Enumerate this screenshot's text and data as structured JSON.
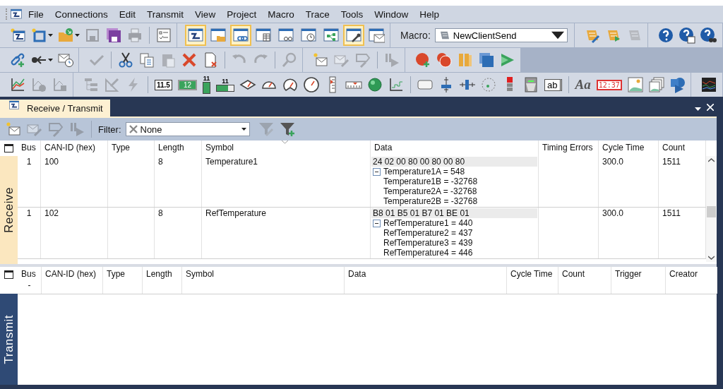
{
  "menu_bar": {
    "items": [
      "File",
      "Connections",
      "Edit",
      "Transmit",
      "View",
      "Project",
      "Macro",
      "Trace",
      "Tools",
      "Window",
      "Help"
    ]
  },
  "toolbars": [
    {
      "groups": [
        {
          "items": [
            {
              "kind": "network-window",
              "disabled": false
            },
            {
              "kind": "window-sparkle",
              "disabled": false,
              "dropdown": true
            },
            {
              "kind": "folder-arrow",
              "disabled": false,
              "dropdown": true
            },
            {
              "kind": "floppy",
              "disabled": true
            },
            {
              "kind": "floppy-stack",
              "disabled": false
            },
            {
              "kind": "printer",
              "disabled": true
            },
            {
              "kind": "separator"
            },
            {
              "kind": "checklist",
              "disabled": false
            }
          ]
        },
        {
          "items": [
            {
              "kind": "window-network",
              "on": true
            },
            {
              "kind": "window-folder",
              "on": false
            },
            {
              "kind": "window-link",
              "on": true
            },
            {
              "kind": "window-table",
              "on": false
            },
            {
              "kind": "window-glasses",
              "on": false
            },
            {
              "kind": "window-clock",
              "on": false
            },
            {
              "kind": "window-nodes",
              "on": false
            },
            {
              "kind": "window-wrench",
              "on": true
            },
            {
              "kind": "window-envelope",
              "on": false
            }
          ]
        },
        {
          "items": [
            {
              "kind": "label",
              "text": "Macro:"
            },
            {
              "kind": "combo",
              "text": "NewClientSend"
            }
          ]
        },
        {
          "items": [
            {
              "kind": "scroll-pencil",
              "disabled": false
            },
            {
              "kind": "scroll-play",
              "disabled": false
            },
            {
              "kind": "scroll",
              "disabled": true
            }
          ]
        },
        {
          "items": [
            {
              "kind": "help",
              "disabled": false
            },
            {
              "kind": "help-window",
              "disabled": false
            },
            {
              "kind": "help-binoculars",
              "disabled": false
            }
          ]
        }
      ]
    },
    {
      "groups": [
        {
          "items": [
            {
              "kind": "link-plus",
              "disabled": false
            },
            {
              "kind": "plug-arrow",
              "disabled": false,
              "dropdown": true
            },
            {
              "kind": "envelope-clock",
              "disabled": false
            }
          ]
        },
        {
          "items": [
            {
              "kind": "checkmark",
              "disabled": true
            },
            {
              "kind": "separator"
            },
            {
              "kind": "scissors",
              "disabled": false
            },
            {
              "kind": "copy",
              "disabled": false
            },
            {
              "kind": "paste",
              "disabled": true
            },
            {
              "kind": "delete-x",
              "disabled": false
            },
            {
              "kind": "document-x",
              "disabled": false
            },
            {
              "kind": "separator"
            },
            {
              "kind": "undo",
              "disabled": true
            },
            {
              "kind": "redo",
              "disabled": true
            },
            {
              "kind": "separator"
            },
            {
              "kind": "magnifier",
              "disabled": true
            }
          ]
        },
        {
          "items": [
            {
              "kind": "envelope-sparkle",
              "disabled": false
            },
            {
              "kind": "envelope-pencil",
              "disabled": true
            },
            {
              "kind": "tag-pencil",
              "disabled": true
            },
            {
              "kind": "separator"
            },
            {
              "kind": "step-play",
              "disabled": true
            }
          ]
        },
        {
          "items": [
            {
              "kind": "record-plus",
              "disabled": false
            },
            {
              "kind": "record-double",
              "disabled": false
            },
            {
              "kind": "pause-bars",
              "disabled": false
            },
            {
              "kind": "stop-squares",
              "disabled": false
            },
            {
              "kind": "play-double",
              "disabled": false
            }
          ]
        }
      ]
    },
    {
      "groups": [
        {
          "items": [
            {
              "kind": "line-chart",
              "disabled": false
            },
            {
              "kind": "chart-circle",
              "disabled": true
            },
            {
              "kind": "chart-square",
              "disabled": true
            }
          ]
        },
        {
          "items": [
            {
              "kind": "tree",
              "disabled": true
            },
            {
              "kind": "ruler-pencil",
              "disabled": true
            },
            {
              "kind": "lightning",
              "disabled": true
            },
            {
              "kind": "separator"
            },
            {
              "kind": "number-display",
              "text": "11.5",
              "disabled": false
            },
            {
              "kind": "digital-display",
              "text": "12",
              "disabled": false
            },
            {
              "kind": "vertical-bar",
              "text": "11",
              "disabled": false
            },
            {
              "kind": "horizontal-bar",
              "text": "11",
              "disabled": false
            },
            {
              "kind": "gauge-flat",
              "disabled": false
            },
            {
              "kind": "gauge-half",
              "disabled": false
            },
            {
              "kind": "gauge-round",
              "disabled": false
            },
            {
              "kind": "gauge-full",
              "disabled": false
            },
            {
              "kind": "vertical-scale",
              "disabled": false
            },
            {
              "kind": "horizontal-scale",
              "disabled": false
            },
            {
              "kind": "ball",
              "disabled": false
            },
            {
              "kind": "small-chart",
              "disabled": false
            },
            {
              "kind": "separator"
            },
            {
              "kind": "rounded-button",
              "disabled": false
            },
            {
              "kind": "vertical-slider",
              "disabled": false
            },
            {
              "kind": "horizontal-slider",
              "disabled": false
            },
            {
              "kind": "led-dial",
              "disabled": false
            },
            {
              "kind": "signal-light",
              "disabled": false
            },
            {
              "kind": "switch-box",
              "disabled": false
            },
            {
              "kind": "text-box",
              "text": "ab",
              "disabled": false
            },
            {
              "kind": "separator"
            },
            {
              "kind": "italic-text",
              "text": "Aa",
              "disabled": false
            },
            {
              "kind": "clock-display",
              "text": "12:37",
              "disabled": false
            },
            {
              "kind": "picture-frame",
              "disabled": false
            },
            {
              "kind": "picture-stack",
              "disabled": false
            },
            {
              "kind": "shapes",
              "disabled": false
            }
          ]
        },
        {
          "items": [
            {
              "kind": "oscilloscope",
              "disabled": false
            }
          ]
        }
      ]
    }
  ],
  "tab": {
    "label": "Receive / Transmit",
    "selected": true
  },
  "panel_toolbar": {
    "items": [
      {
        "kind": "envelope-sparkle",
        "disabled": false
      },
      {
        "kind": "envelope-pencil",
        "disabled": true
      },
      {
        "kind": "tag-pencil",
        "disabled": true
      },
      {
        "kind": "step-play",
        "disabled": true
      }
    ],
    "filter": {
      "label": "Filter:",
      "value": "None"
    },
    "filter_items": [
      {
        "kind": "filter-pencil",
        "disabled": true
      },
      {
        "kind": "filter-plus",
        "disabled": false
      }
    ]
  },
  "receive": {
    "label": "Receive",
    "columns": [
      "Bus",
      "CAN-ID (hex)",
      "Type",
      "Length",
      "Symbol",
      "Data",
      "Timing Errors",
      "Cycle Time",
      "Count"
    ],
    "rows": [
      {
        "bus": "1",
        "can_id": "100",
        "length": "8",
        "symbol": "Temperature1",
        "data": "24 02 00 80 00 80 00 80",
        "expanded": true,
        "signals": [
          "Temperature1A = 548",
          "Temperature1B = -32768",
          "Temperature2A = -32768",
          "Temperature2B = -32768"
        ],
        "cycle_time": "300.0",
        "count": "1511"
      },
      {
        "bus": "1",
        "can_id": "102",
        "length": "8",
        "symbol": "RefTemperature",
        "data": "B8 01 B5 01 B7 01 BE 01",
        "expanded": true,
        "signals": [
          "RefTemperature1 = 440",
          "RefTemperature2 = 437",
          "RefTemperature3 = 439",
          "RefTemperature4 = 446"
        ],
        "cycle_time": "300.0",
        "count": "1511"
      }
    ]
  },
  "transmit": {
    "label": "Transmit",
    "columns": [
      {
        "label": "Bus",
        "second_line": "-"
      },
      {
        "label": "CAN-ID (hex)"
      },
      {
        "label": "Type"
      },
      {
        "label": "Length"
      },
      {
        "label": "Symbol"
      },
      {
        "label": "Data"
      },
      {
        "label": "Cycle Time"
      },
      {
        "label": "Count"
      },
      {
        "label": "Trigger"
      },
      {
        "label": "Creator"
      }
    ]
  }
}
